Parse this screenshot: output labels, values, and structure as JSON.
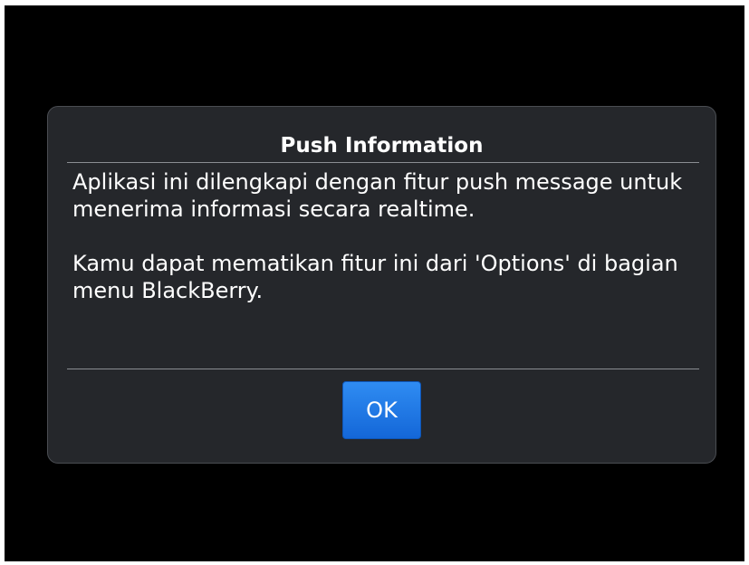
{
  "dialog": {
    "title": "Push Information",
    "paragraphs": [
      "Aplikasi ini dilengkapi dengan fitur push message untuk menerima informasi secara realtime.",
      "Kamu dapat mematikan fitur ini dari 'Options' di bagian menu BlackBerry."
    ],
    "ok_label": "OK"
  },
  "colors": {
    "background": "#000000",
    "dialog_background": "#25272b",
    "accent": "#1e78e8",
    "text": "#ffffff"
  }
}
